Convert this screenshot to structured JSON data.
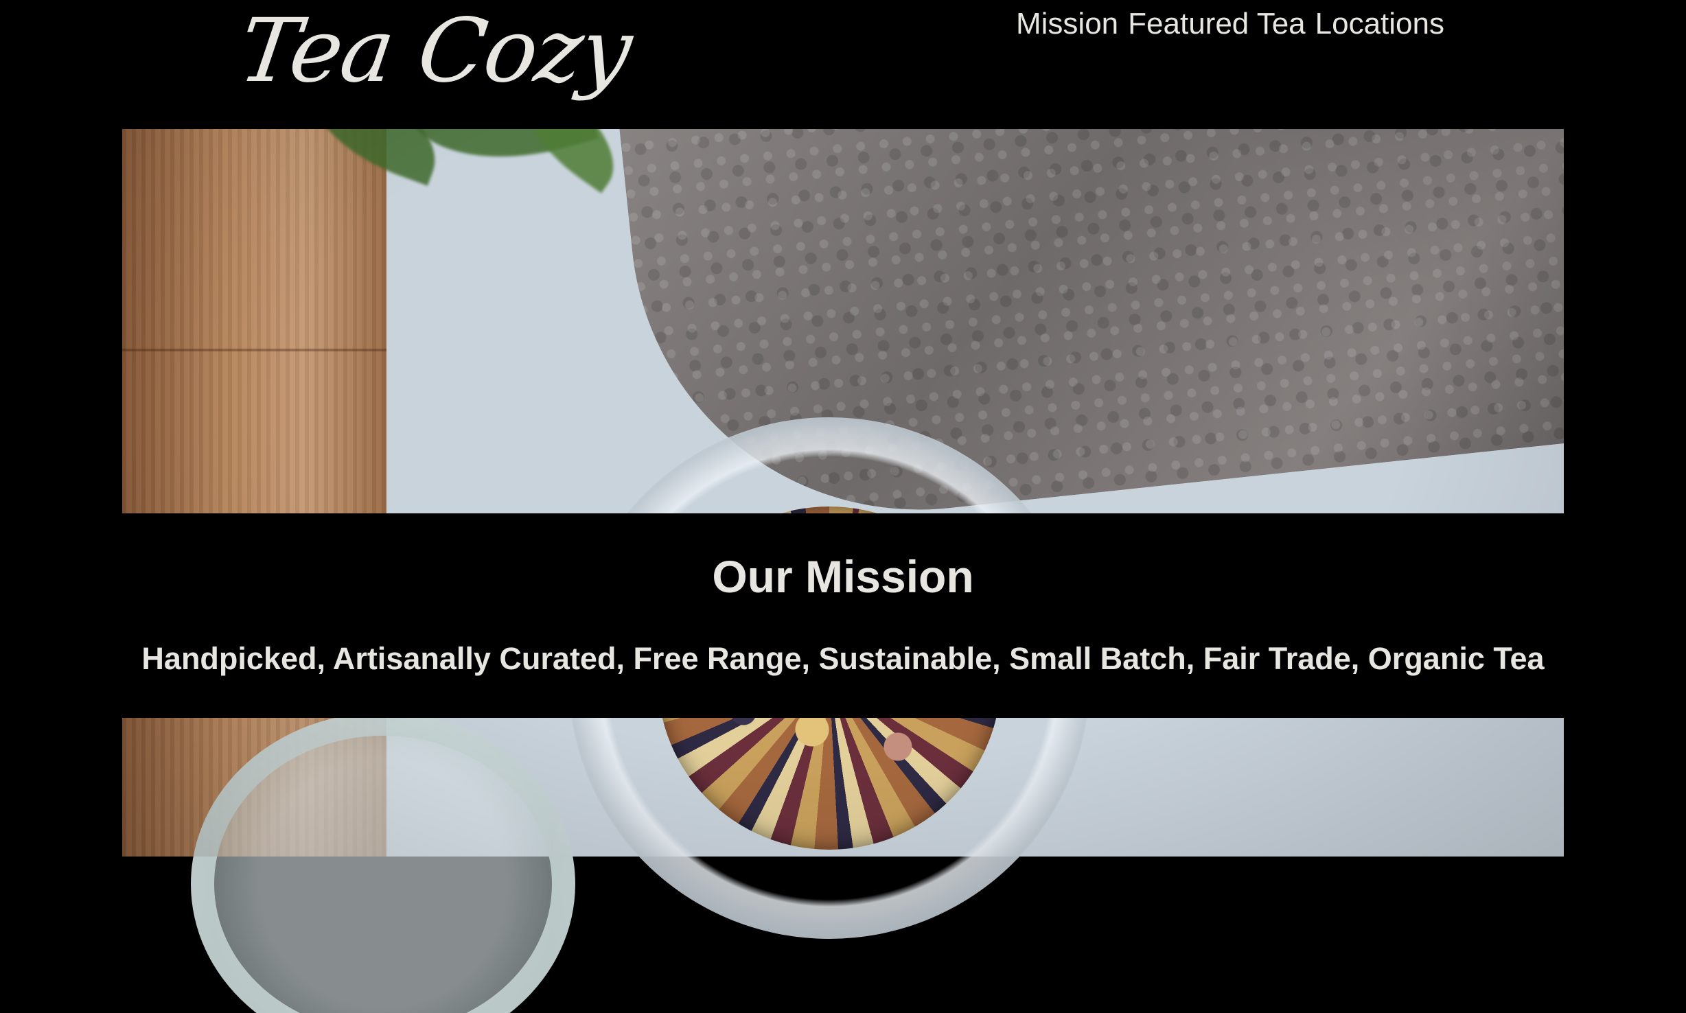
{
  "brand": {
    "logo_text": "Tea Cozy"
  },
  "nav": {
    "items": [
      {
        "label": "Mission"
      },
      {
        "label": "Featured Tea"
      },
      {
        "label": "Locations"
      }
    ]
  },
  "mission": {
    "heading": "Our Mission",
    "tagline": "Handpicked, Artisanally Curated, Free Range, Sustainable, Small Batch, Fair Trade, Organic Tea"
  },
  "colors": {
    "background": "#000000",
    "text": "#e8e6e1"
  }
}
